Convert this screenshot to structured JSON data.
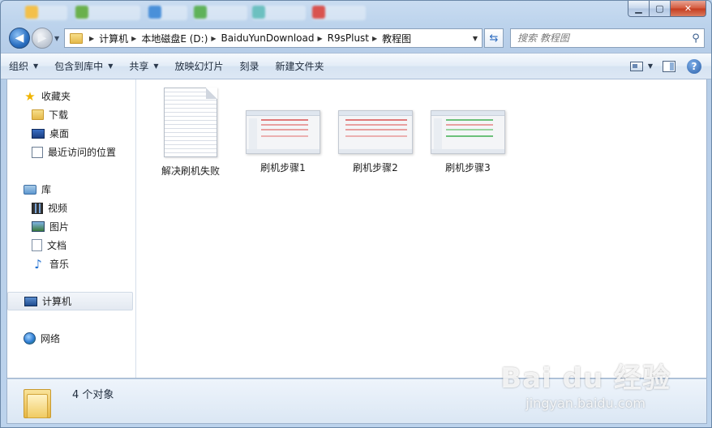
{
  "window": {
    "caption": {
      "minimize": "▁",
      "maximize": "▢",
      "close": "✕"
    }
  },
  "navigation": {
    "breadcrumbs": [
      "计算机",
      "本地磁盘E (D:)",
      "BaiduYunDownload",
      "R9sPlust",
      "教程图"
    ]
  },
  "search": {
    "placeholder": "搜索 教程图"
  },
  "toolbar": {
    "organize": "组织",
    "include_in_library": "包含到库中",
    "share": "共享",
    "slideshow": "放映幻灯片",
    "burn": "刻录",
    "new_folder": "新建文件夹"
  },
  "sidebar": {
    "favorites": {
      "label": "收藏夹",
      "items": [
        "下载",
        "桌面",
        "最近访问的位置"
      ]
    },
    "libraries": {
      "label": "库",
      "items": [
        "视频",
        "图片",
        "文档",
        "音乐"
      ]
    },
    "computer": {
      "label": "计算机"
    },
    "network": {
      "label": "网络"
    }
  },
  "files": [
    {
      "name": "解决刷机失败",
      "type": "document"
    },
    {
      "name": "刷机步骤1",
      "type": "image"
    },
    {
      "name": "刷机步骤2",
      "type": "image"
    },
    {
      "name": "刷机步骤3",
      "type": "image"
    }
  ],
  "status": {
    "count": "4 个对象"
  },
  "watermark": {
    "brand": "Bai du 经验",
    "url": "jingyan.baidu.com"
  },
  "colors": {
    "accent": "#2a6fc1",
    "frame": "#bcd3ec"
  }
}
